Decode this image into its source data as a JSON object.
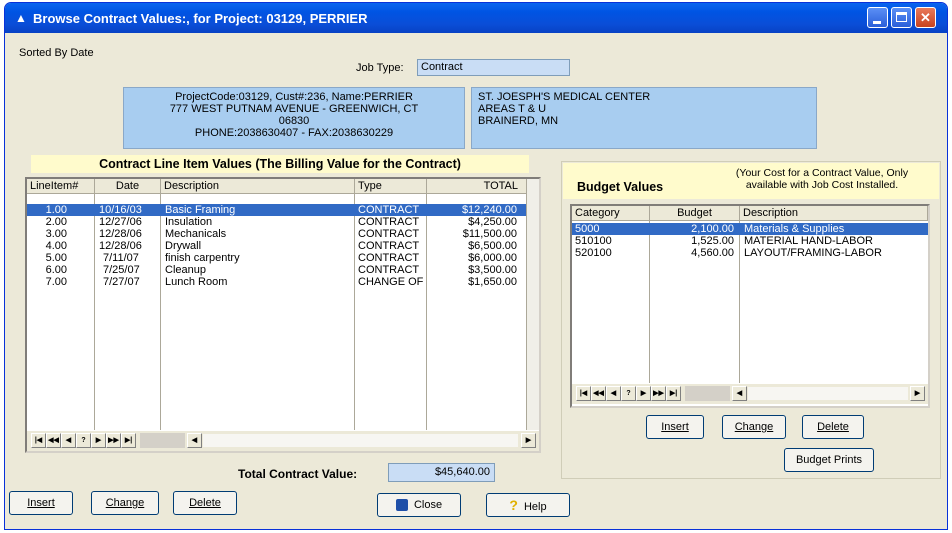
{
  "window": {
    "title": "Browse Contract Values:, for Project: 03129, PERRIER"
  },
  "sorted_by": "Sorted By Date",
  "job_type": {
    "label": "Job Type:",
    "value": "Contract"
  },
  "project_info": {
    "line1": "ProjectCode:03129,  Cust#:236, Name:PERRIER",
    "line2": "777 WEST PUTNAM AVENUE  -  GREENWICH, CT",
    "line3": "06830",
    "line4": "PHONE:2038630407    - FAX:2038630229"
  },
  "customer_info": {
    "line1": "ST. JOESPH'S MEDICAL CENTER",
    "line2": "AREAS T & U",
    "line3": "BRAINERD, MN"
  },
  "contract": {
    "heading": "Contract Line Item Values (The Billing Value for the Contract)",
    "columns": [
      "LineItem#",
      "Date",
      "Description",
      "Type",
      "TOTAL"
    ],
    "rows": [
      {
        "item": "1.00",
        "date": "10/16/03",
        "desc": "Basic Framing",
        "type": "CONTRACT",
        "total": "$12,240.00"
      },
      {
        "item": "2.00",
        "date": "12/27/06",
        "desc": "Insulation",
        "type": "CONTRACT",
        "total": "$4,250.00"
      },
      {
        "item": "3.00",
        "date": "12/28/06",
        "desc": "Mechanicals",
        "type": "CONTRACT",
        "total": "$11,500.00"
      },
      {
        "item": "4.00",
        "date": "12/28/06",
        "desc": "Drywall",
        "type": "CONTRACT",
        "total": "$6,500.00"
      },
      {
        "item": "5.00",
        "date": "7/11/07",
        "desc": "finish carpentry",
        "type": "CONTRACT",
        "total": "$6,000.00"
      },
      {
        "item": "6.00",
        "date": "7/25/07",
        "desc": "Cleanup",
        "type": "CONTRACT",
        "total": "$3,500.00"
      },
      {
        "item": "7.00",
        "date": "7/27/07",
        "desc": "Lunch Room",
        "type": "CHANGE OF",
        "total": "$1,650.00"
      }
    ],
    "total_label": "Total Contract Value:",
    "total_value": "$45,640.00"
  },
  "budget": {
    "heading": "Budget Values",
    "note_line1": "(Your Cost for a Contract Value, Only",
    "note_line2": "available with Job Cost Installed.",
    "columns": [
      "Category",
      "Budget",
      "Description"
    ],
    "rows": [
      {
        "category": "5000",
        "budget": "2,100.00",
        "desc": "Materials & Supplies"
      },
      {
        "category": "510100",
        "budget": "1,525.00",
        "desc": "MATERIAL HAND-LABOR"
      },
      {
        "category": "520100",
        "budget": "4,560.00",
        "desc": "LAYOUT/FRAMING-LABOR"
      }
    ],
    "buttons": {
      "insert": "Insert",
      "change": "Change",
      "delete": "Delete",
      "prints": "Budget Prints"
    }
  },
  "bottom_buttons": {
    "insert": "Insert",
    "change": "Change",
    "delete": "Delete",
    "close": "Close",
    "help": "Help"
  },
  "nav_buttons": [
    "|◀",
    "◀◀",
    "◀",
    "?",
    "▶",
    "▶▶",
    "▶|"
  ],
  "colors": {
    "selection": "#316ac5",
    "info_bg": "#a8cdf0",
    "banner_bg": "#fffbcc"
  }
}
